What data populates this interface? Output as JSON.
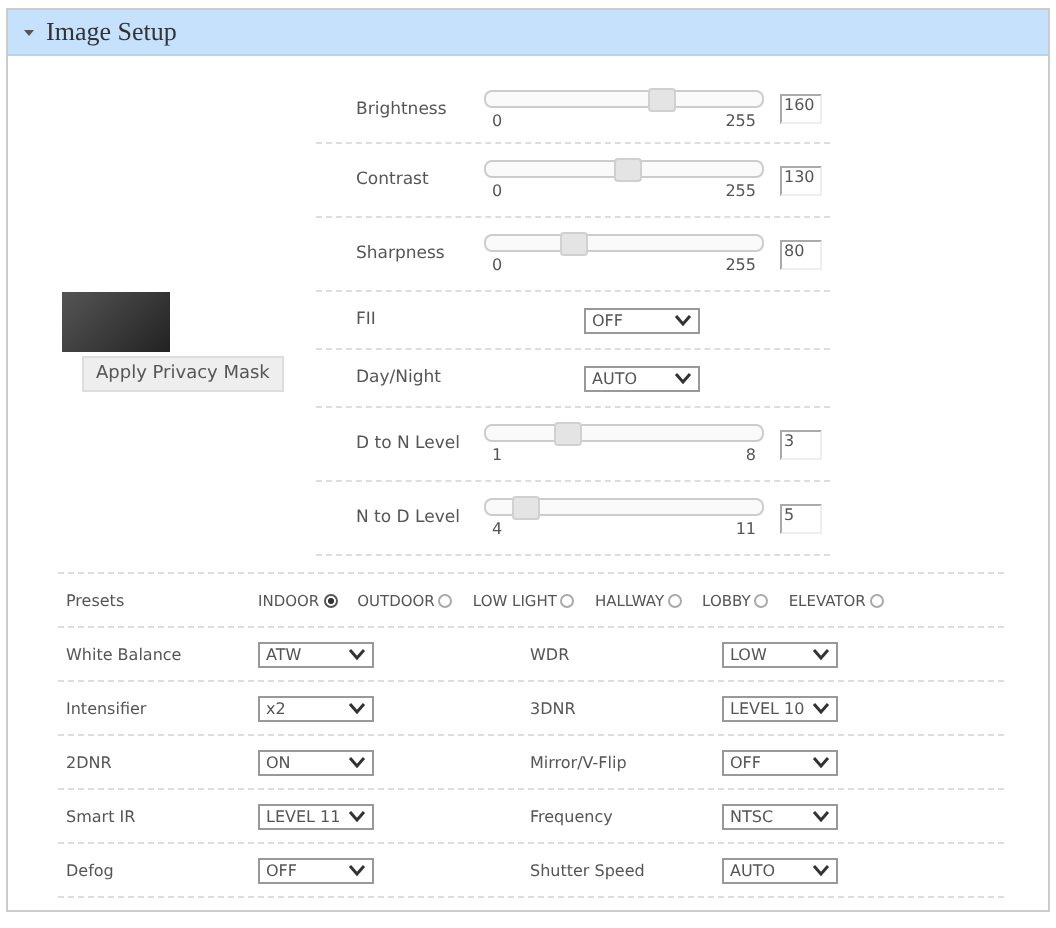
{
  "section": {
    "title": "Image Setup",
    "expanded": true
  },
  "preview": {
    "button": "Apply Privacy Mask"
  },
  "controls": [
    {
      "kind": "slider",
      "label": "Brightness",
      "min": "0",
      "max": "255",
      "level": 0.63,
      "value": "160"
    },
    {
      "kind": "slider",
      "label": "Contrast",
      "min": "0",
      "max": "255",
      "level": 0.51,
      "value": "130"
    },
    {
      "kind": "slider",
      "label": "Sharpness",
      "min": "0",
      "max": "255",
      "level": 0.31,
      "value": "80"
    },
    {
      "kind": "select",
      "label": "FII",
      "value": "OFF"
    },
    {
      "kind": "select",
      "label": "Day/Night",
      "value": "AUTO"
    },
    {
      "kind": "slider",
      "label": "D to N Level",
      "min": "1",
      "max": "8",
      "level": 0.29,
      "value": "3"
    },
    {
      "kind": "slider",
      "label": "N to D Level",
      "min": "4",
      "max": "11",
      "level": 0.14,
      "value": "5"
    }
  ],
  "presets": {
    "label": "Presets",
    "options": [
      {
        "label": "INDOOR",
        "selected": true
      },
      {
        "label": "OUTDOOR",
        "selected": false
      },
      {
        "label": "LOW LIGHT",
        "selected": false
      },
      {
        "label": "HALLWAY",
        "selected": false
      },
      {
        "label": "LOBBY",
        "selected": false
      },
      {
        "label": "ELEVATOR",
        "selected": false
      }
    ]
  },
  "settings": [
    [
      {
        "label": "White Balance",
        "value": "ATW"
      },
      {
        "label": "WDR",
        "value": "LOW"
      }
    ],
    [
      {
        "label": "Intensifier",
        "value": "x2"
      },
      {
        "label": "3DNR",
        "value": "LEVEL 10"
      }
    ],
    [
      {
        "label": "2DNR",
        "value": "ON"
      },
      {
        "label": "Mirror/V-Flip",
        "value": "OFF"
      }
    ],
    [
      {
        "label": "Smart IR",
        "value": "LEVEL 11"
      },
      {
        "label": "Frequency",
        "value": "NTSC"
      }
    ],
    [
      {
        "label": "Defog",
        "value": "OFF"
      },
      {
        "label": "Shutter Speed",
        "value": "AUTO"
      }
    ]
  ]
}
